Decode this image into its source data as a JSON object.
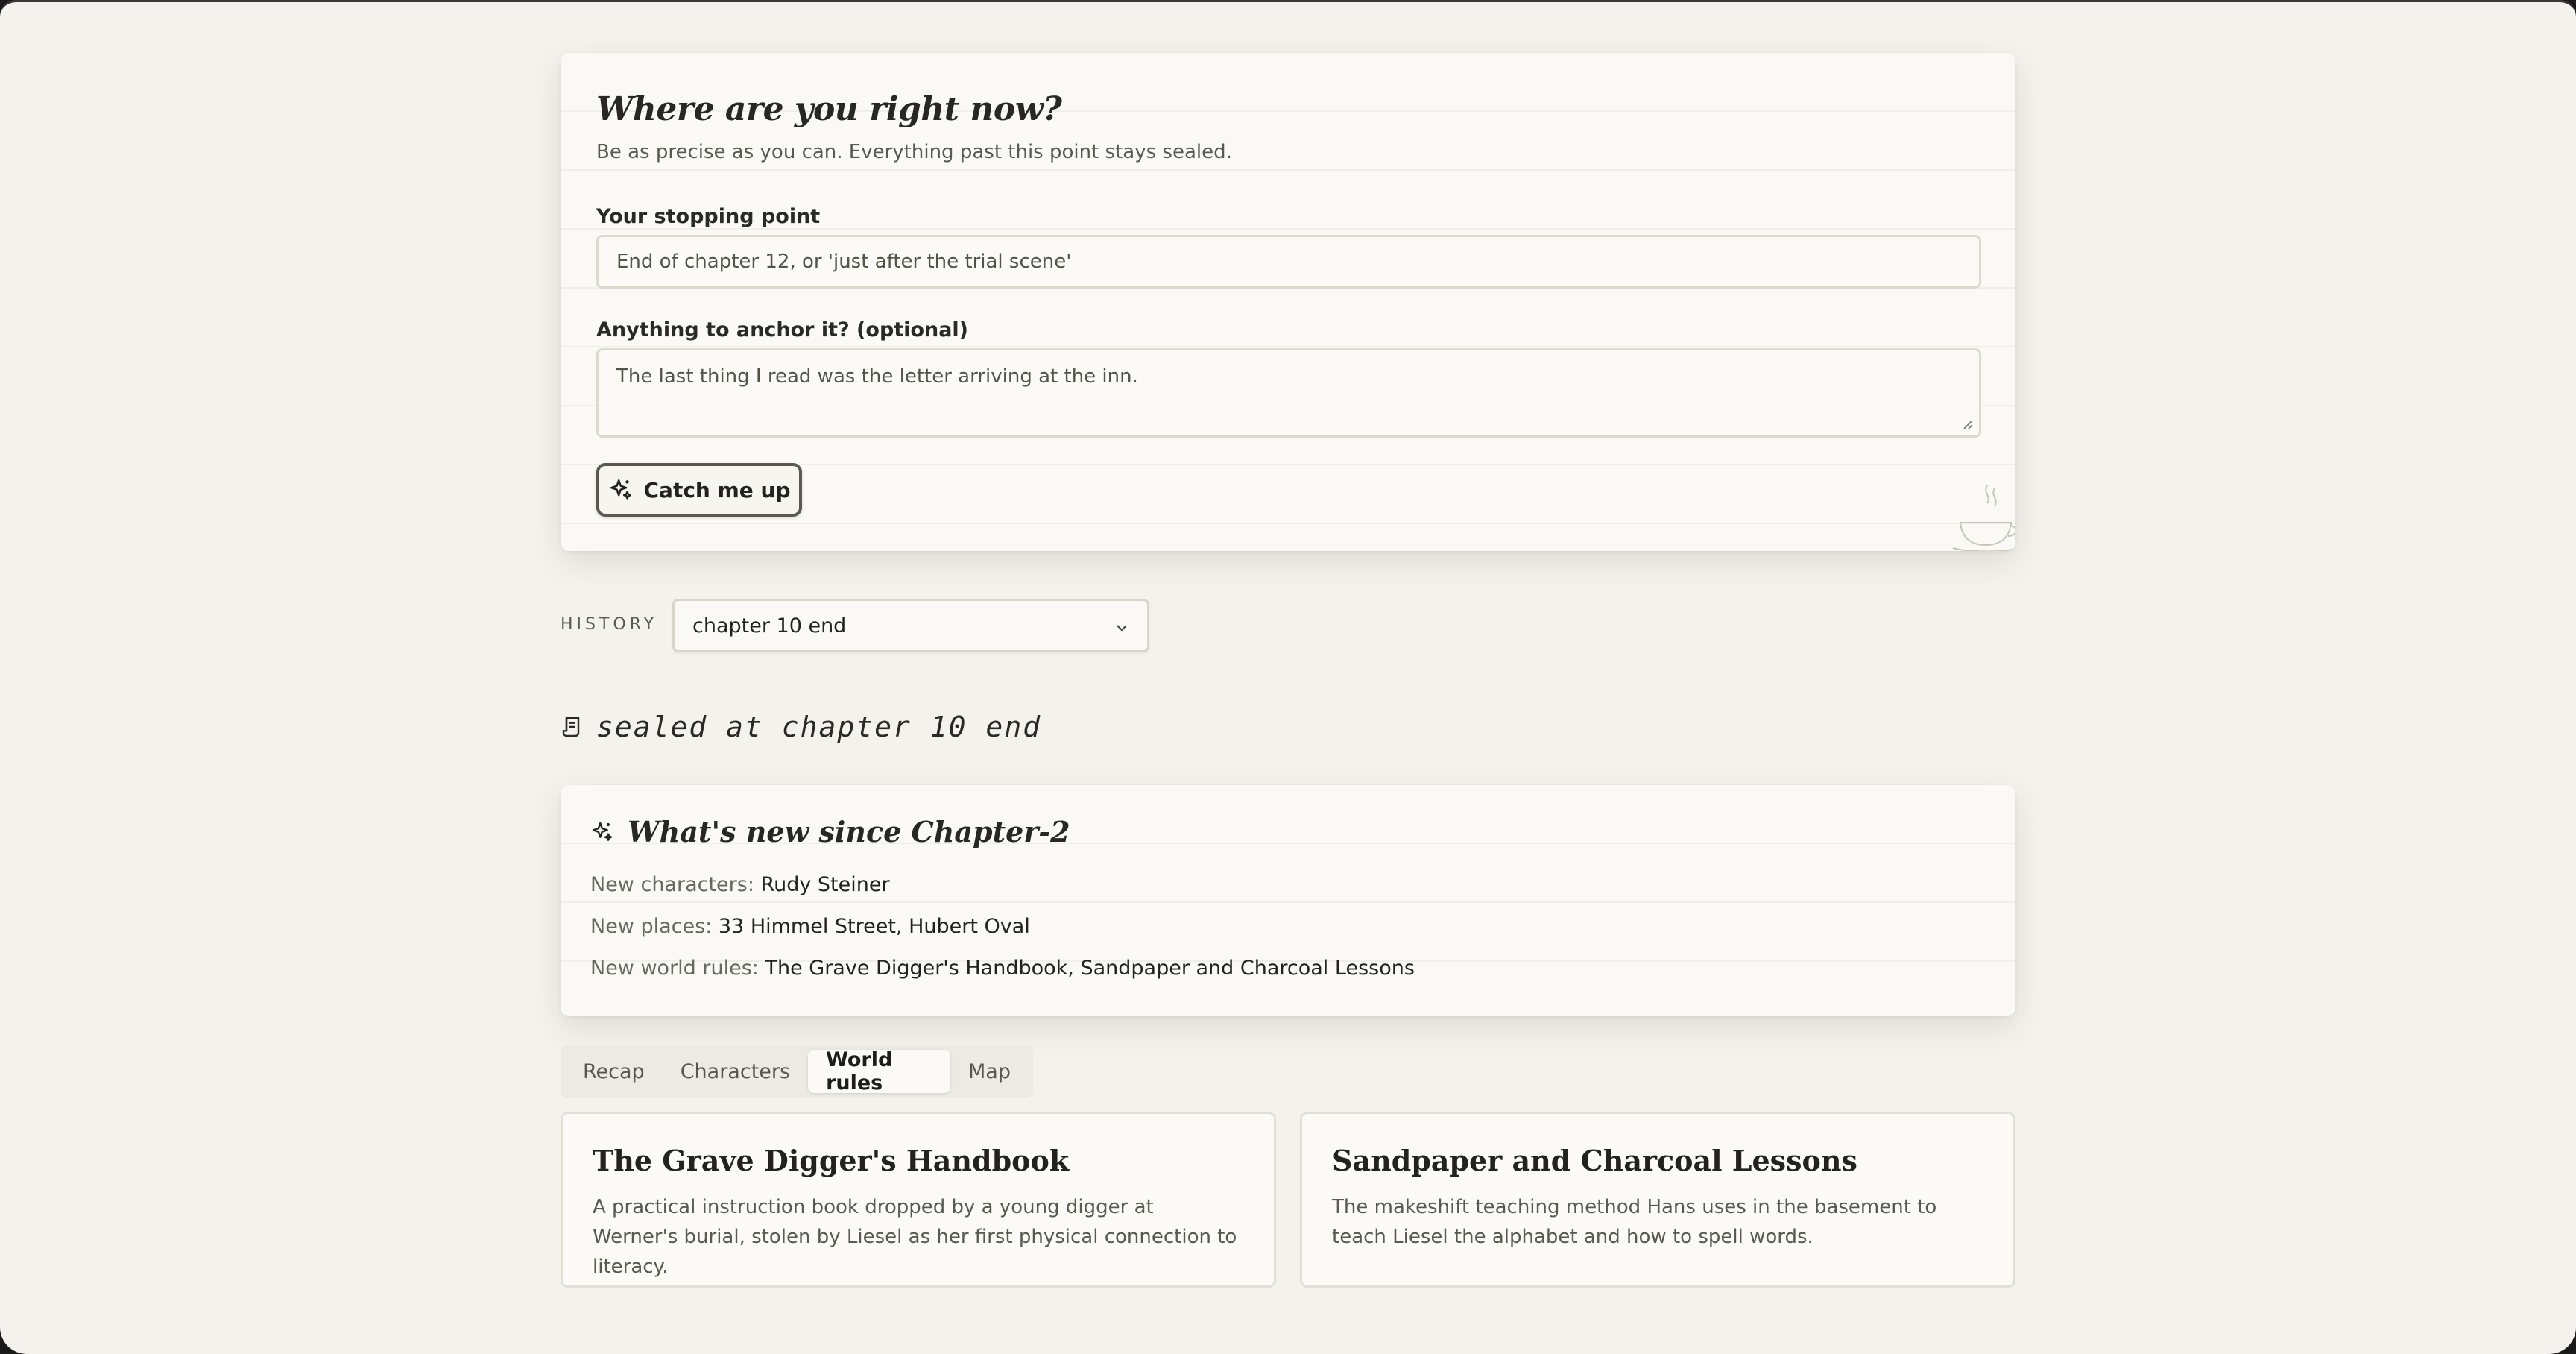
{
  "prompt_card": {
    "title": "Where are you right now?",
    "subtitle": "Be as precise as you can. Everything past this point stays sealed.",
    "stopping_point_label": "Your stopping point",
    "stopping_point_placeholder": "End of chapter 12, or 'just after the trial scene'",
    "anchor_label": "Anything to anchor it? (optional)",
    "anchor_placeholder": "The last thing I read was the letter arriving at the inn.",
    "submit_label": "Catch me up",
    "submit_icon": "sparkles-icon",
    "decoration_icon": "teacup-icon"
  },
  "history": {
    "label": "HISTORY",
    "selected": "chapter 10 end"
  },
  "sealed": {
    "icon": "scroll-icon",
    "text": "sealed at chapter 10 end"
  },
  "whats_new": {
    "icon": "sparkles-icon",
    "title": "What's new since Chapter-2",
    "rows": [
      {
        "label": "New characters:",
        "value": "Rudy Steiner"
      },
      {
        "label": "New places:",
        "value": "33 Himmel Street, Hubert Oval"
      },
      {
        "label": "New world rules:",
        "value": "The Grave Digger's Handbook, Sandpaper and Charcoal Lessons"
      }
    ]
  },
  "tabs": [
    {
      "label": "Recap",
      "active": false
    },
    {
      "label": "Characters",
      "active": false
    },
    {
      "label": "World rules",
      "active": true
    },
    {
      "label": "Map",
      "active": false
    }
  ],
  "world_rules": [
    {
      "title": "The Grave Digger's Handbook",
      "description": "A practical instruction book dropped by a young digger at Werner's burial, stolen by Liesel as her first physical connection to literacy."
    },
    {
      "title": "Sandpaper and Charcoal Lessons",
      "description": "The makeshift teaching method Hans uses in the basement to teach Liesel the alphabet and how to spell words."
    }
  ],
  "colors": {
    "background": "#f3f2ec",
    "card": "#faf9f5",
    "text": "#2b2925",
    "muted": "#5b5850"
  }
}
